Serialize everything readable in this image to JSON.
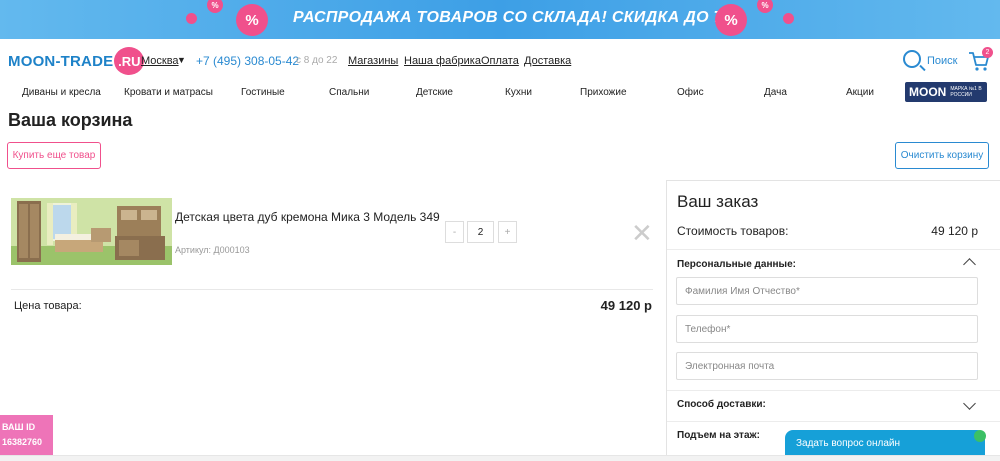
{
  "banner": {
    "text": "РАСПРОДАЖА ТОВАРОВ СО СКЛАДА! СКИДКА ДО 70%",
    "percent_sign": "%"
  },
  "header": {
    "logo_text": "MOON-TRADE",
    "logo_suffix": ".RU",
    "city": "Москва",
    "phone": "+7 (495) 308-05-42",
    "hours": "с 8 до 22",
    "links": [
      "Магазины",
      "Наша фабрика",
      "Оплата",
      "Доставка"
    ],
    "search_label": "Поиск",
    "cart_count": "2"
  },
  "nav": {
    "items": [
      "Диваны и кресла",
      "Кровати и матрасы",
      "Гостиные",
      "Спальни",
      "Детские",
      "Кухни",
      "Прихожие",
      "Офис",
      "Дача",
      "Акции"
    ],
    "brand_badge": "MOON",
    "brand_sub": "МАРКА №1 В РОССИИ"
  },
  "cart": {
    "title": "Ваша корзина",
    "buy_more": "Купить еще товар",
    "clear": "Очистить корзину",
    "item": {
      "name": "Детская цвета дуб кремона Мика 3 Модель 349",
      "sku": "Артикул: Д000103",
      "minus": "-",
      "qty": "2",
      "plus": "+",
      "remove": "✕"
    },
    "price_label": "Цена товара:",
    "price_value": "49 120 р"
  },
  "order": {
    "title": "Ваш заказ",
    "cost_label": "Стоимость товаров:",
    "cost_value": "49 120 р",
    "personal_label": "Персональные данные:",
    "name_placeholder": "Фамилия Имя Отчество*",
    "phone_placeholder": "Телефон*",
    "email_placeholder": "Электронная почта",
    "delivery_label": "Способ доставки:",
    "floor_label": "Подъем на этаж:"
  },
  "chat": {
    "label": "Задать вопрос онлайн"
  },
  "user_id": {
    "label": "ВАШ ID",
    "value": "16382760"
  },
  "colors": {
    "accent_blue": "#2a8ad1",
    "accent_pink": "#f0508c",
    "brand_navy": "#233a6e",
    "chat_blue": "#16a0d8"
  }
}
